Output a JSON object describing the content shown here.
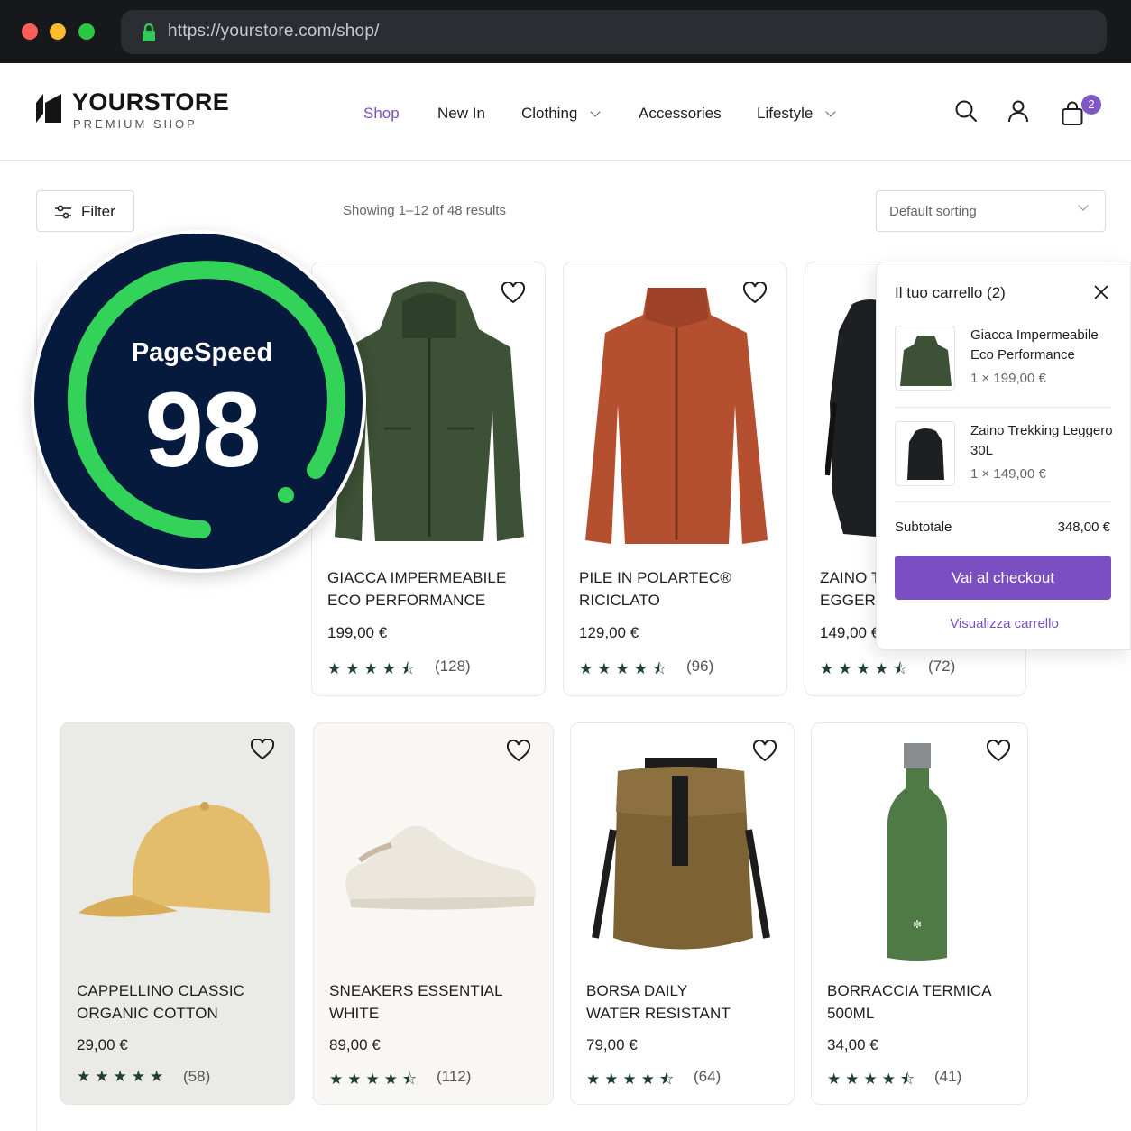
{
  "browser": {
    "url": "https://yourstore.com/shop/"
  },
  "brand": {
    "name": "YOURSTORE",
    "tagline": "PREMIUM SHOP"
  },
  "nav": {
    "items": [
      {
        "label": "Shop",
        "active": true
      },
      {
        "label": "New In"
      },
      {
        "label": "Clothing",
        "dropdown": true
      },
      {
        "label": "Accessories"
      },
      {
        "label": "Lifestyle",
        "dropdown": true
      }
    ],
    "cart_count": "2"
  },
  "toolbar": {
    "filter_label": "Filter",
    "results_text": "Showing 1–12 of 48 results",
    "sort_value": "Default sorting"
  },
  "pagespeed": {
    "label": "PageSpeed",
    "score": "98"
  },
  "products": [
    {
      "name_line1": "GIACCA IMPERMEABILE",
      "name_line2": "ECO PERFORMANCE",
      "price": "199,00 €",
      "stars": "★★★★⯪",
      "reviews": "(128)"
    },
    {
      "name_line1": "PILE IN POLARTEC®",
      "name_line2": "RICICLATO",
      "price": "129,00 €",
      "stars": "★★★★⯪",
      "reviews": "(96)"
    },
    {
      "name_line1": "ZAINO T",
      "name_line2": "EGGERO",
      "price": "149,00 €",
      "stars": "★★★★⯪",
      "reviews": "(72)"
    },
    {
      "name_line1": "CAPPELLINO CLASSIC",
      "name_line2": "ORGANIC COTTON",
      "price": "29,00 €",
      "stars": "★★★★★",
      "reviews": "(58)"
    },
    {
      "name_line1": "SNEAKERS ESSENTIAL",
      "name_line2": "WHITE",
      "price": "89,00 €",
      "stars": "★★★★⯪",
      "reviews": "(112)"
    },
    {
      "name_line1": "BORSA DAILY",
      "name_line2": "WATER RESISTANT",
      "price": "79,00 €",
      "stars": "★★★★⯪",
      "reviews": "(64)"
    },
    {
      "name_line1": "BORRACCIA TERMICA",
      "name_line2": "500ML",
      "price": "34,00 €",
      "stars": "★★★★⯪",
      "reviews": "(41)"
    }
  ],
  "minicart": {
    "title": "Il tuo carrello (2)",
    "items": [
      {
        "name": "Giacca Impermeabile Eco Performance",
        "qty": "1 × 199,00 €"
      },
      {
        "name": "Zaino Trekking Leggero 30L",
        "qty": "1 × 149,00 €"
      }
    ],
    "subtotal_label": "Subtotale",
    "subtotal_value": "348,00 €",
    "checkout_label": "Vai al checkout",
    "view_cart_label": "Visualizza carrello"
  },
  "colors": {
    "accent": "#7b4fc2",
    "badge_bg": "#061a3e",
    "score_ring": "#33d35a",
    "star": "#1f4032"
  },
  "icons": [
    "lock-icon",
    "search-icon",
    "user-icon",
    "bag-icon",
    "filter-sliders-icon",
    "heart-icon",
    "close-icon",
    "chevron-down-icon"
  ]
}
